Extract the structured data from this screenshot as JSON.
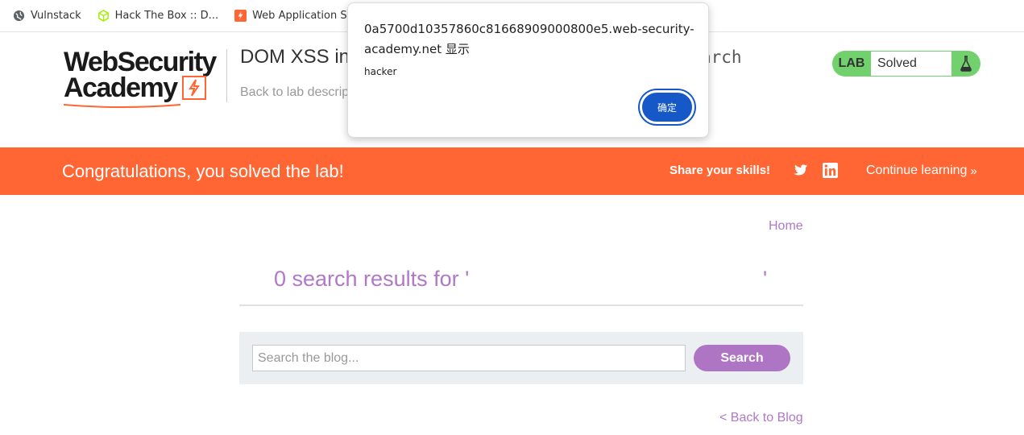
{
  "bookmarks": [
    {
      "label": "Vulnstack",
      "icon": "globe-icon"
    },
    {
      "label": "Hack The Box :: D...",
      "icon": "htb-cube-icon"
    },
    {
      "label": "Web Application S...",
      "icon": "portswigger-bolt-icon"
    },
    {
      "label": "",
      "icon": "github-icon"
    }
  ],
  "header": {
    "logo_line1": "WebSecurity",
    "logo_line2": "Academy",
    "lab_title": "DOM XSS in",
    "lab_title_tail": "arch",
    "back_link": "Back to lab descrip",
    "lab_badge": {
      "label": "LAB",
      "status": "Solved"
    }
  },
  "banner": {
    "congrats": "Congratulations, you solved the lab!",
    "share": "Share your skills!",
    "continue": "Continue learning",
    "continue_chevron": "»"
  },
  "main": {
    "home_link": "Home",
    "results_text": "0 search results for '",
    "results_close_quote": "'",
    "search_placeholder": "Search the blog...",
    "search_value": "",
    "search_button": "Search",
    "back_to_blog": "< Back to Blog"
  },
  "dialog": {
    "origin": "0a5700d10357860c81668909000800e5.web-security-academy.net 显示",
    "message": "hacker",
    "ok_button": "确定"
  },
  "colors": {
    "brand_orange": "#ff6633",
    "lab_green": "#70d16d",
    "link_purple": "#b078c8",
    "button_purple": "#ae75c5",
    "dialog_blue": "#1758c8"
  }
}
